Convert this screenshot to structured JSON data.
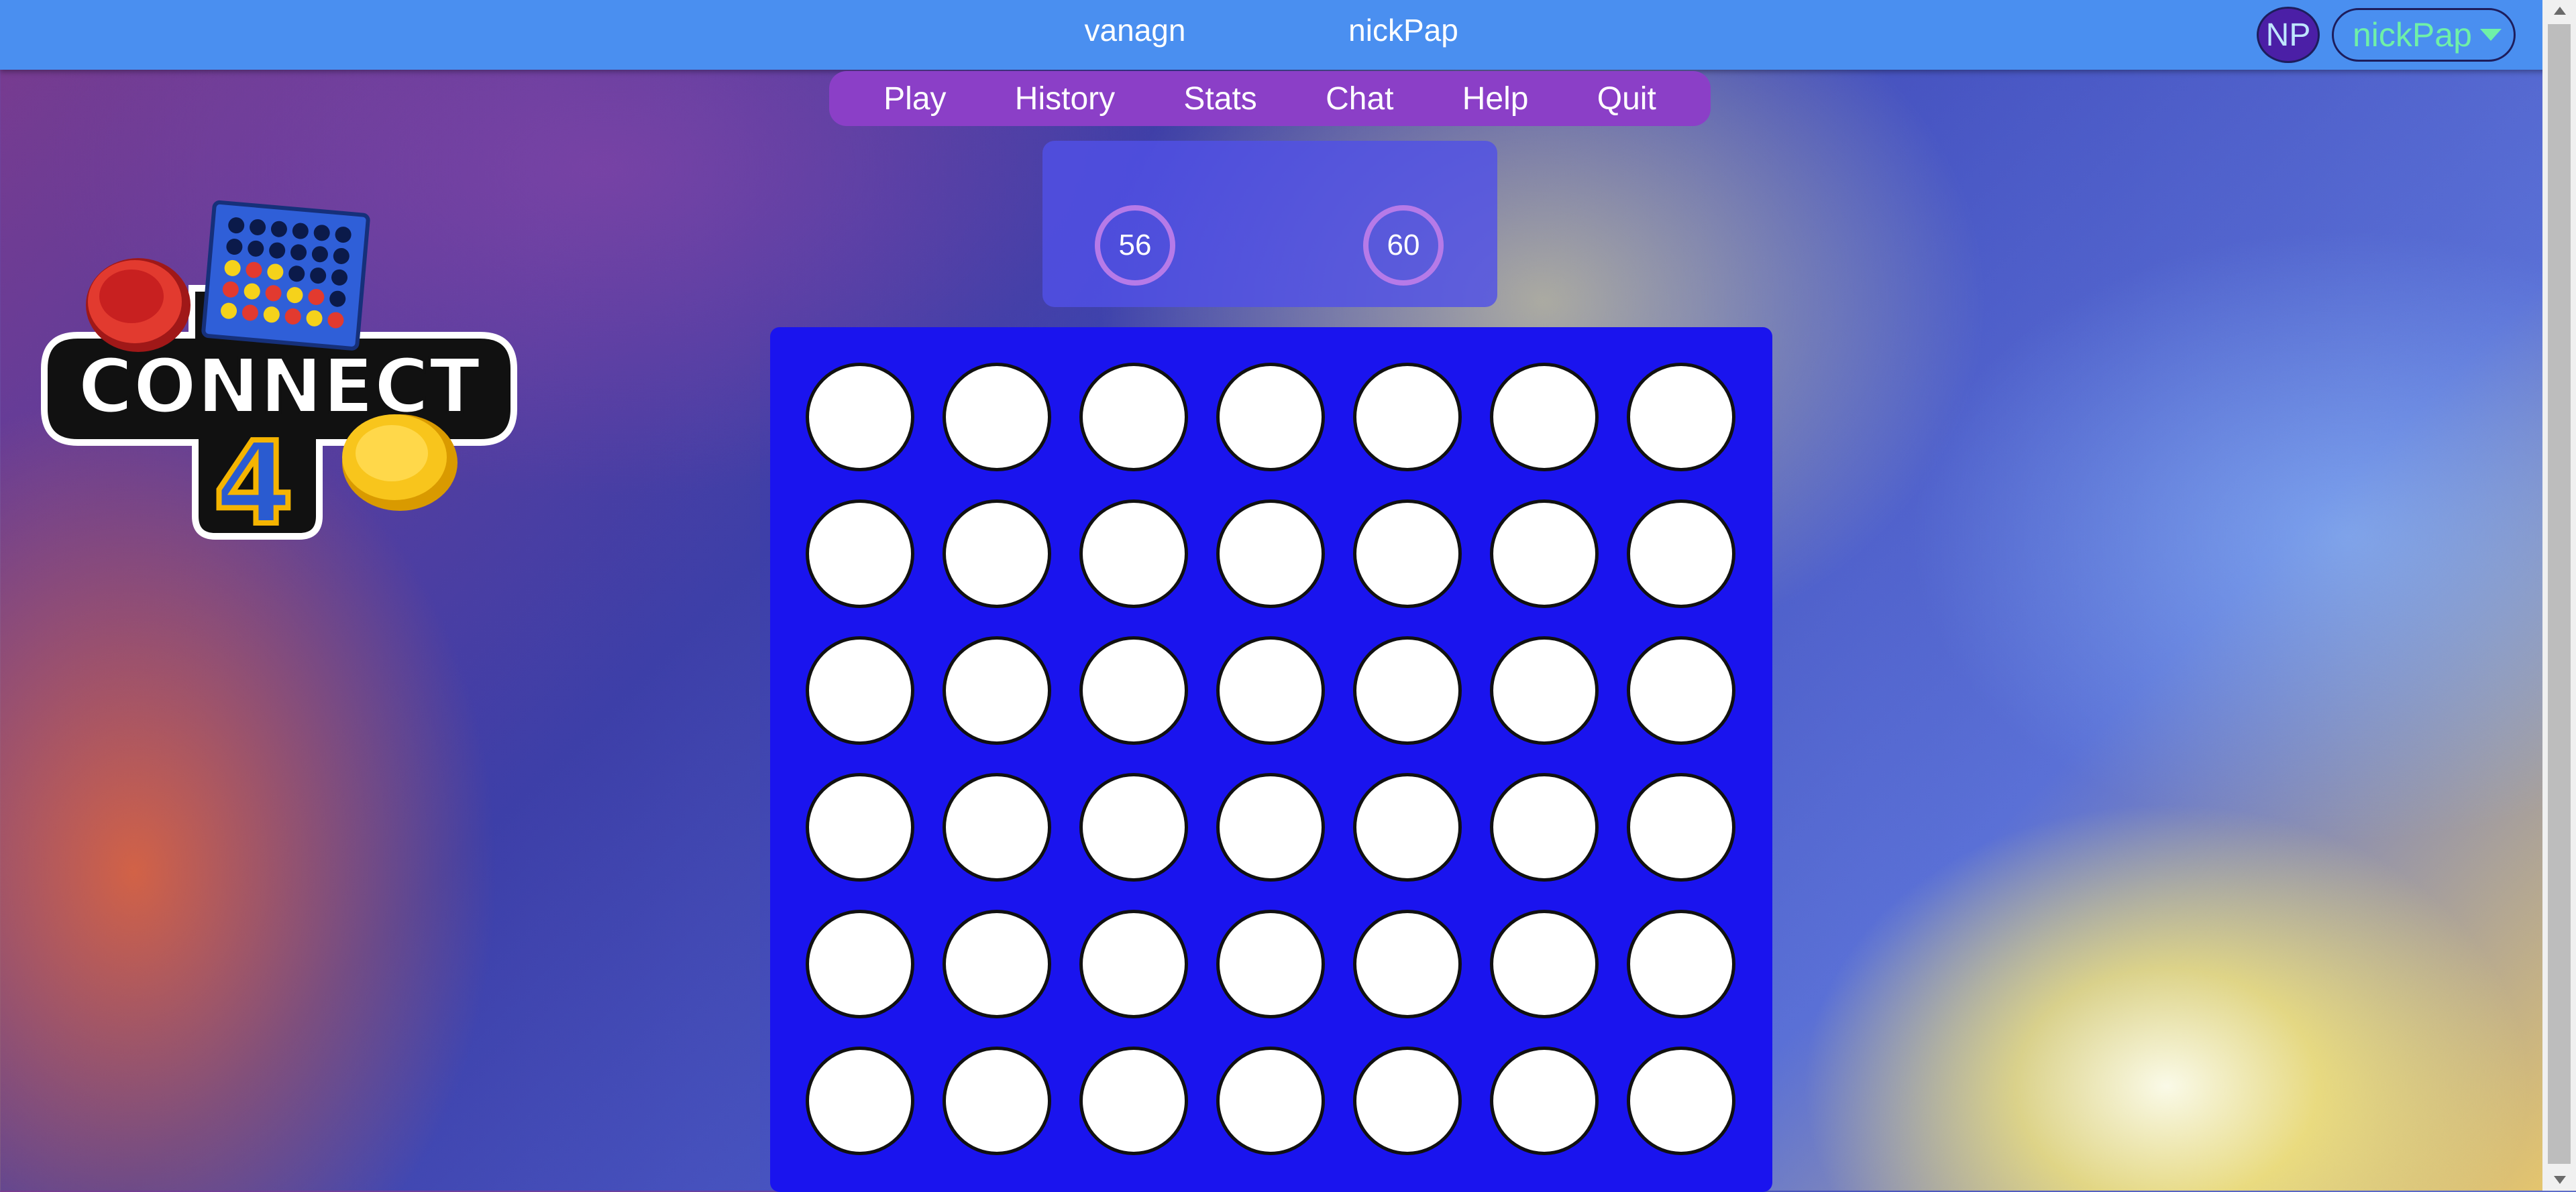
{
  "header": {
    "avatar_initials": "NP",
    "username": "nickPap",
    "bar_color": "#4a8ff0",
    "username_color": "#6ff0a8"
  },
  "nav": {
    "items": [
      "Play",
      "History",
      "Stats",
      "Chat",
      "Help",
      "Quit"
    ],
    "color": "#8b3fc7"
  },
  "logo": {
    "word": "CONNECT",
    "number": "4"
  },
  "scoreboard": {
    "players": [
      {
        "name": "vanagn",
        "score": "56"
      },
      {
        "name": "nickPap",
        "score": "60"
      }
    ]
  },
  "board": {
    "rows": 6,
    "columns": 7,
    "color": "#1a14ee",
    "empty_cell_color": "#ffffff"
  }
}
